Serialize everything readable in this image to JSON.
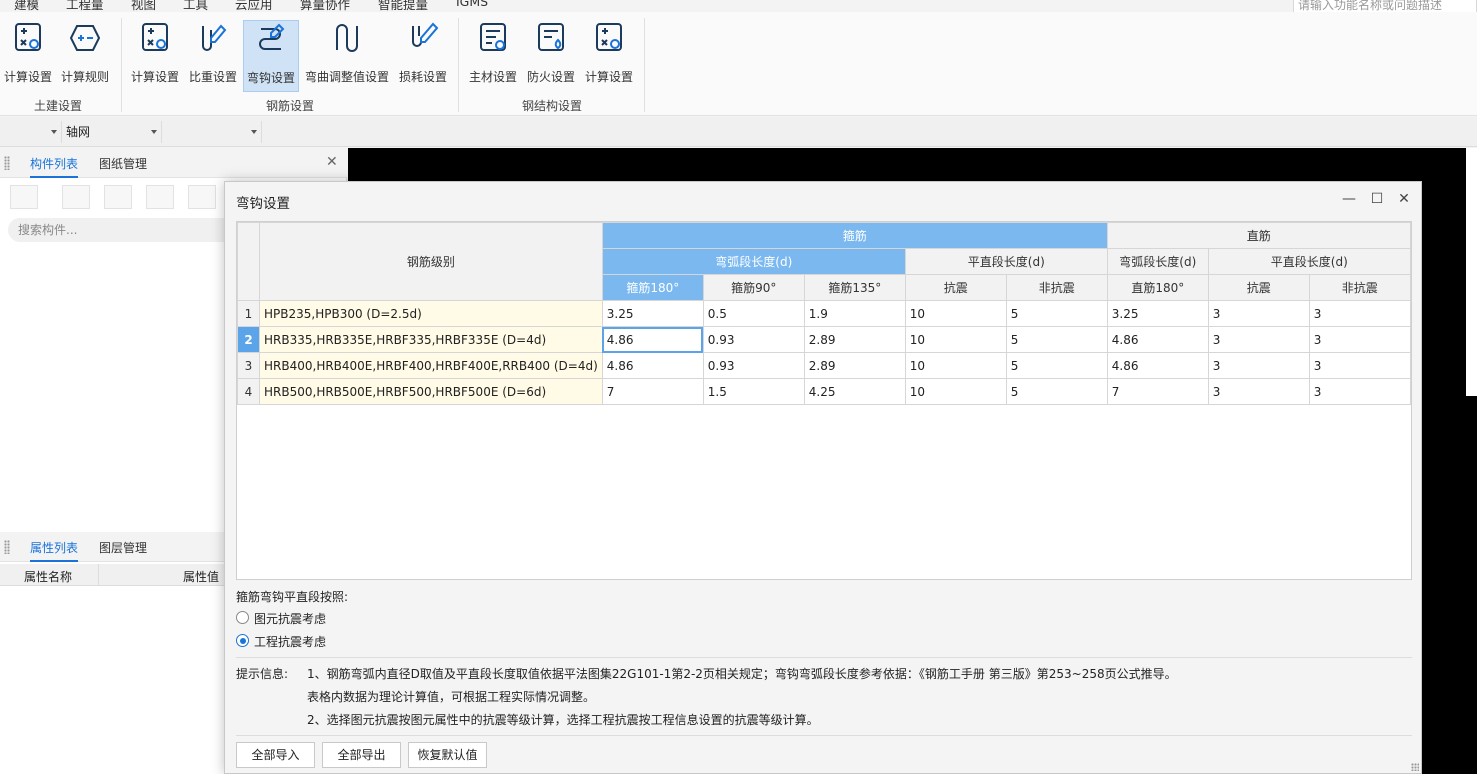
{
  "menu": {
    "items": [
      "建模",
      "工程量",
      "视图",
      "工具",
      "云应用",
      "算量协作",
      "智能提量",
      "IGMS"
    ],
    "search_placeholder": "请输入功能名称或问题描述"
  },
  "ribbon": {
    "groups": [
      {
        "label": "土建设置",
        "buttons": [
          "计算设置",
          "计算规则"
        ]
      },
      {
        "label": "钢筋设置",
        "buttons": [
          "计算设置",
          "比重设置",
          "弯钩设置",
          "弯曲调整值设置",
          "损耗设置"
        ]
      },
      {
        "label": "钢结构设置",
        "buttons": [
          "主材设置",
          "防火设置",
          "计算设置"
        ]
      }
    ],
    "active_button": "弯钩设置"
  },
  "toolbar": {
    "combo2": "轴网"
  },
  "left_panel": {
    "tabs": [
      "构件列表",
      "图纸管理"
    ],
    "search_placeholder": "搜索构件...",
    "prop_tabs": [
      "属性列表",
      "图层管理"
    ],
    "prop_cols": [
      "属性名称",
      "属性值"
    ]
  },
  "dialog": {
    "title": "弯钩设置",
    "headers": {
      "grade": "钢筋级别",
      "stirrup": "箍筋",
      "straight": "直筋",
      "arc_len": "弯弧段长度(d)",
      "flat_len": "平直段长度(d)",
      "s180": "箍筋180°",
      "s90": "箍筋90°",
      "s135": "箍筋135°",
      "seismic": "抗震",
      "non_seismic": "非抗震",
      "z_arc_len": "弯弧段长度(d)",
      "z_flat_len": "平直段长度(d)",
      "z180": "直筋180°",
      "z_seismic": "抗震",
      "z_non_seismic": "非抗震"
    },
    "rows": [
      {
        "no": "1",
        "grade": "HPB235,HPB300 (D=2.5d)",
        "v": [
          "3.25",
          "0.5",
          "1.9",
          "10",
          "5",
          "3.25",
          "3",
          "3"
        ]
      },
      {
        "no": "2",
        "grade": "HRB335,HRB335E,HRBF335,HRBF335E (D=4d)",
        "v": [
          "4.86",
          "0.93",
          "2.89",
          "10",
          "5",
          "4.86",
          "3",
          "3"
        ]
      },
      {
        "no": "3",
        "grade": "HRB400,HRB400E,HRBF400,HRBF400E,RRB400 (D=4d)",
        "v": [
          "4.86",
          "0.93",
          "2.89",
          "10",
          "5",
          "4.86",
          "3",
          "3"
        ]
      },
      {
        "no": "4",
        "grade": "HRB500,HRB500E,HRBF500,HRBF500E (D=6d)",
        "v": [
          "7",
          "1.5",
          "4.25",
          "10",
          "5",
          "7",
          "3",
          "3"
        ]
      }
    ],
    "radio_group_label": "箍筋弯钩平直段按照:",
    "radio_options": [
      "图元抗震考虑",
      "工程抗震考虑"
    ],
    "radio_selected": 1,
    "info_label": "提示信息:",
    "info_lines": [
      "1、钢筋弯弧内直径D取值及平直段长度取值依据平法图集22G101-1第2-2页相关规定；弯钩弯弧段长度参考依据：《钢筋工手册 第三版》第253~258页公式推导。",
      "表格内数据为理论计算值，可根据工程实际情况调整。",
      "2、选择图元抗震按图元属性中的抗震等级计算，选择工程抗震按工程信息设置的抗震等级计算。"
    ],
    "buttons": [
      "全部导入",
      "全部导出",
      "恢复默认值"
    ]
  }
}
